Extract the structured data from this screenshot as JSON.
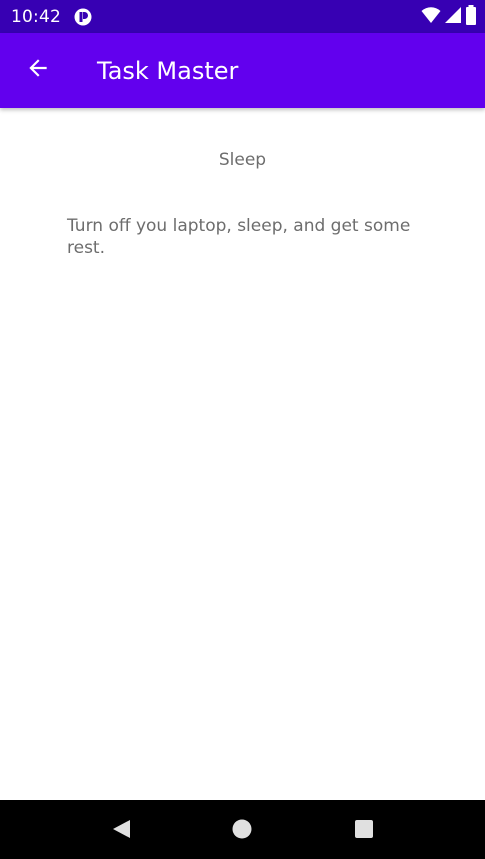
{
  "status_bar": {
    "time": "10:42",
    "icons": [
      "app-notification-icon",
      "wifi-icon",
      "cellular-signal-icon",
      "battery-icon"
    ],
    "background": "#3700b3"
  },
  "app_bar": {
    "title": "Task Master",
    "back_icon": "arrow-back-icon",
    "background": "#6200ee"
  },
  "task": {
    "title": "Sleep",
    "body": "Turn off you laptop, sleep, and get some rest."
  },
  "nav_bar": {
    "buttons": [
      "back-triangle-icon",
      "home-circle-icon",
      "recents-square-icon"
    ],
    "background": "#000000"
  }
}
